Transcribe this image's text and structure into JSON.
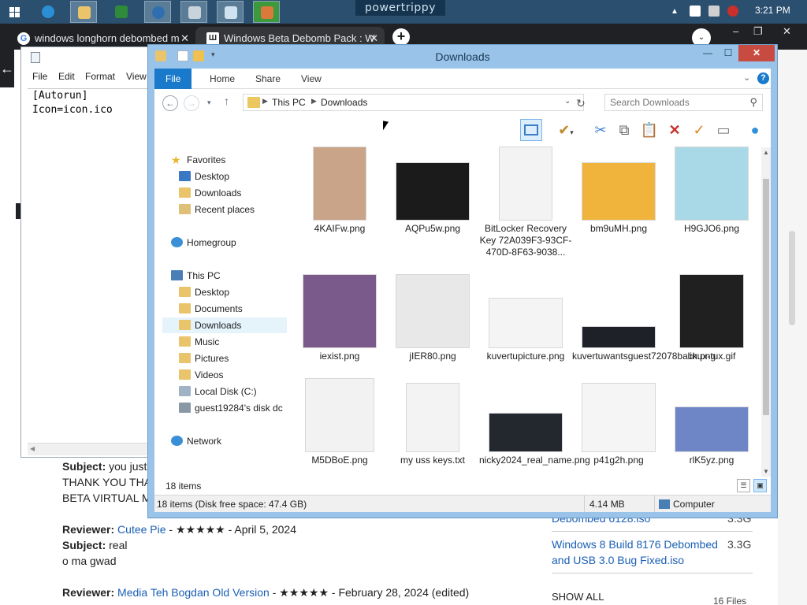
{
  "taskbar": {
    "brand": "powertrippy",
    "clock": "3:21 PM",
    "apps": [
      {
        "name": "ie-icon",
        "color": "#2b8fd6"
      },
      {
        "name": "file-explorer-icon",
        "color": "#e9c46a"
      },
      {
        "name": "spreadsheet-icon",
        "color": "#2e8b3a"
      },
      {
        "name": "globe-icon",
        "color": "#2f6fb0"
      },
      {
        "name": "printer-icon",
        "color": "#c9d3dc"
      },
      {
        "name": "notepad-icon",
        "color": "#cfe2f1"
      },
      {
        "name": "paint-icon",
        "color": "#d97a3c"
      }
    ]
  },
  "browser": {
    "tabs": [
      {
        "title": "windows longhorn debombed m",
        "favicon": "G",
        "close": "✕"
      },
      {
        "title": "Windows Beta Debomb Pack : W",
        "favicon": "Ш",
        "close": "✕"
      }
    ],
    "new_tab": "+",
    "menu_icon": "⌄",
    "controls": {
      "min": "–",
      "max": "❐",
      "close": "✕"
    },
    "back_icon": "←",
    "reviews": [
      {
        "label": "Subject:",
        "text": "you just"
      },
      {
        "text": "THANK YOU THA"
      },
      {
        "text": "BETA VIRTUAL M"
      },
      {
        "label": "Reviewer:",
        "link": "Cutee Pie",
        "tail": " - ★★★★★ - April 5, 2024"
      },
      {
        "label": "Subject:",
        "text": "real"
      },
      {
        "text": "o ma gwad"
      },
      {
        "label": "Reviewer:",
        "link": "Media Teh Bogdan Old Version",
        "tail": " - ★★★★★ - February 28, 2024 (edited)"
      }
    ],
    "side_files": [
      {
        "name": "Debombed 6128.iso",
        "size": "3.3G"
      },
      {
        "name": "Windows 8 Build 8176 Debombed",
        "name2": "and USB 3.0 Bug Fixed.iso",
        "size": "3.3G"
      }
    ],
    "show_all": "SHOW ALL",
    "file_count": "16 Files"
  },
  "notepad": {
    "menu": [
      "File",
      "Edit",
      "Format",
      "View"
    ],
    "content": "[Autorun]\nIcon=icon.ico"
  },
  "explorer": {
    "title": "Downloads",
    "window_controls": {
      "min": "—",
      "max": "☐",
      "close": "✕"
    },
    "ribbon_tabs": [
      "File",
      "Home",
      "Share",
      "View"
    ],
    "address": {
      "root": "This PC",
      "current": "Downloads"
    },
    "search_placeholder": "Search Downloads",
    "nav": {
      "favorites": "Favorites",
      "desktop": "Desktop",
      "downloads": "Downloads",
      "recent": "Recent places",
      "homegroup": "Homegroup",
      "this_pc": "This PC",
      "pc_desktop": "Desktop",
      "documents": "Documents",
      "pc_downloads": "Downloads",
      "music": "Music",
      "pictures": "Pictures",
      "videos": "Videos",
      "local_disk": "Local Disk (C:)",
      "guest_disk": "guest19284's disk dc",
      "network": "Network"
    },
    "files": [
      {
        "name": "4KAIFw.png",
        "thumb": "#c9a489"
      },
      {
        "name": "AQPu5w.png",
        "thumb": "#1b1b1b"
      },
      {
        "name": "BitLocker Recovery Key 72A039F3-93CF-470D-8F63-9038...",
        "thumb": "#f3f3f3"
      },
      {
        "name": "bm9uMH.png",
        "thumb": "#f0b43c"
      },
      {
        "name": "H9GJO6.png",
        "thumb": "#a9d8e6"
      },
      {
        "name": "iexist.png",
        "thumb": "#7a5a8a"
      },
      {
        "name": "jIER80.png",
        "thumb": "#e8e8e8"
      },
      {
        "name": "kuvertupicture.png",
        "thumb": "#f4f4f4"
      },
      {
        "name": "kuvertuwantsguest72078back.png",
        "thumb": "#1e2228"
      },
      {
        "name": "linux-tux.gif",
        "thumb": "#202020"
      },
      {
        "name": "M5DBoE.png",
        "thumb": "#f2f2f2"
      },
      {
        "name": "my uss keys.txt",
        "thumb": "#f3f3f3"
      },
      {
        "name": "nicky2024_real_name.png",
        "thumb": "#23272e"
      },
      {
        "name": "p41g2h.png",
        "thumb": "#f5f5f5"
      },
      {
        "name": "rlK5yz.png",
        "thumb": "#6f86c6"
      }
    ],
    "item_count": "18 items",
    "status": {
      "summary": "18 items (Disk free space: 47.4 GB)",
      "size": "4.14 MB",
      "location": "Computer"
    }
  }
}
